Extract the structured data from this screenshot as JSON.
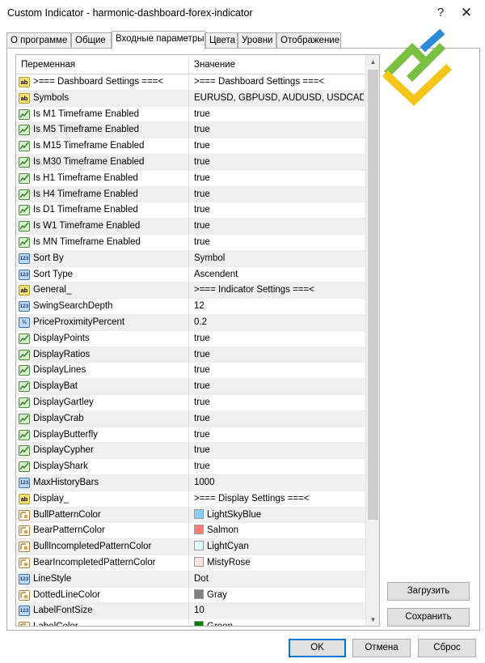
{
  "window": {
    "title": "Custom Indicator - harmonic-dashboard-forex-indicator",
    "help_glyph": "?",
    "close_glyph": "✕"
  },
  "tabs": [
    {
      "label": "О программе"
    },
    {
      "label": "Общие"
    },
    {
      "label": "Входные параметры"
    },
    {
      "label": "Цвета"
    },
    {
      "label": "Уровни"
    },
    {
      "label": "Отображение"
    }
  ],
  "active_tab": "Входные параметры",
  "grid": {
    "col_variable": "Переменная",
    "col_value": "Значение",
    "rows": [
      {
        "icon": "ab",
        "name": ">=== Dashboard Settings ===<",
        "value": ">=== Dashboard Settings ===<"
      },
      {
        "icon": "ab",
        "name": "Symbols",
        "value": "EURUSD, GBPUSD, AUDUSD, USDCAD..."
      },
      {
        "icon": "bool",
        "name": "Is M1 Timeframe Enabled",
        "value": "true"
      },
      {
        "icon": "bool",
        "name": "Is M5 Timeframe Enabled",
        "value": "true"
      },
      {
        "icon": "bool",
        "name": "Is M15 Timeframe Enabled",
        "value": "true"
      },
      {
        "icon": "bool",
        "name": "Is M30 Timeframe Enabled",
        "value": "true"
      },
      {
        "icon": "bool",
        "name": "Is H1 Timeframe Enabled",
        "value": "true"
      },
      {
        "icon": "bool",
        "name": "Is H4 Timeframe Enabled",
        "value": "true"
      },
      {
        "icon": "bool",
        "name": "Is D1 Timeframe Enabled",
        "value": "true"
      },
      {
        "icon": "bool",
        "name": "Is W1 Timeframe Enabled",
        "value": "true"
      },
      {
        "icon": "bool",
        "name": "Is MN Timeframe Enabled",
        "value": "true"
      },
      {
        "icon": "num",
        "name": "Sort By",
        "value": "Symbol"
      },
      {
        "icon": "num",
        "name": "Sort Type",
        "value": "Ascendent"
      },
      {
        "icon": "ab",
        "name": "General_",
        "value": ">=== Indicator Settings ===<"
      },
      {
        "icon": "num",
        "name": "SwingSearchDepth",
        "value": "12"
      },
      {
        "icon": "half",
        "name": "PriceProximityPercent",
        "value": "0.2"
      },
      {
        "icon": "bool",
        "name": "DisplayPoints",
        "value": "true"
      },
      {
        "icon": "bool",
        "name": "DisplayRatios",
        "value": "true"
      },
      {
        "icon": "bool",
        "name": "DisplayLines",
        "value": "true"
      },
      {
        "icon": "bool",
        "name": "DisplayBat",
        "value": "true"
      },
      {
        "icon": "bool",
        "name": "DisplayGartley",
        "value": "true"
      },
      {
        "icon": "bool",
        "name": "DisplayCrab",
        "value": "true"
      },
      {
        "icon": "bool",
        "name": "DisplayButterfly",
        "value": "true"
      },
      {
        "icon": "bool",
        "name": "DisplayCypher",
        "value": "true"
      },
      {
        "icon": "bool",
        "name": "DisplayShark",
        "value": "true"
      },
      {
        "icon": "num",
        "name": "MaxHistoryBars",
        "value": "1000"
      },
      {
        "icon": "ab",
        "name": "Display_",
        "value": ">=== Display Settings ===<"
      },
      {
        "icon": "color",
        "name": "BullPatternColor",
        "value": "LightSkyBlue",
        "swatch": "#87cefa"
      },
      {
        "icon": "color",
        "name": "BearPatternColor",
        "value": "Salmon",
        "swatch": "#fa8072"
      },
      {
        "icon": "color",
        "name": "BullIncompletedPatternColor",
        "value": "LightCyan",
        "swatch": "#e0ffff"
      },
      {
        "icon": "color",
        "name": "BearIncompletedPatternColor",
        "value": "MistyRose",
        "swatch": "#ffe4e1"
      },
      {
        "icon": "num",
        "name": "LineStyle",
        "value": "Dot"
      },
      {
        "icon": "color",
        "name": "DottedLineColor",
        "value": "Gray",
        "swatch": "#808080"
      },
      {
        "icon": "num",
        "name": "LabelFontSize",
        "value": "10"
      },
      {
        "icon": "color",
        "name": "LabelColor",
        "value": "Green",
        "swatch": "#008000"
      }
    ]
  },
  "icon_glyphs": {
    "ab": "ab",
    "num": "123",
    "half": "½"
  },
  "buttons": {
    "load": "Загрузить",
    "save": "Сохранить",
    "ok": "OK",
    "cancel": "Отмена",
    "reset": "Сброс"
  },
  "colors": {
    "accent": "#0078d7",
    "logo_green": "#7ac143",
    "logo_yellow": "#f5c518",
    "logo_blue": "#2b8bd8"
  }
}
